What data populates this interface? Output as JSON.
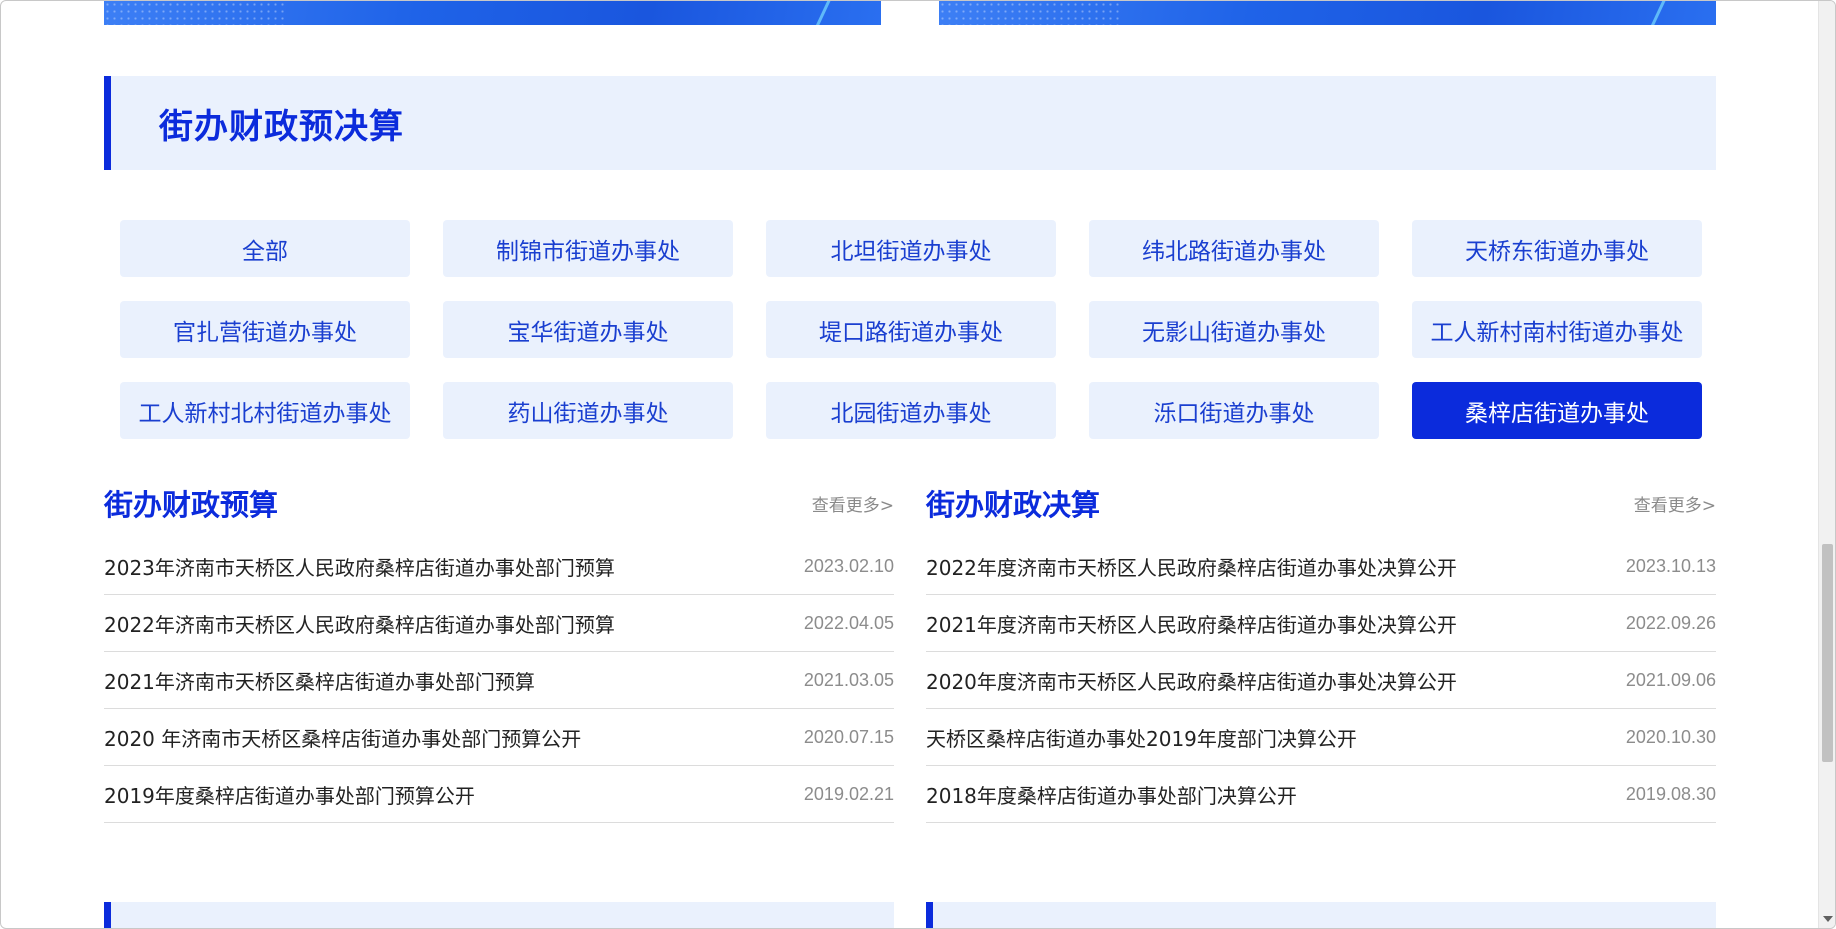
{
  "section": {
    "title": "街办财政预决算"
  },
  "filters": [
    {
      "label": "全部",
      "active": false
    },
    {
      "label": "制锦市街道办事处",
      "active": false
    },
    {
      "label": "北坦街道办事处",
      "active": false
    },
    {
      "label": "纬北路街道办事处",
      "active": false
    },
    {
      "label": "天桥东街道办事处",
      "active": false
    },
    {
      "label": "官扎营街道办事处",
      "active": false
    },
    {
      "label": "宝华街道办事处",
      "active": false
    },
    {
      "label": "堤口路街道办事处",
      "active": false
    },
    {
      "label": "无影山街道办事处",
      "active": false
    },
    {
      "label": "工人新村南村街道办事处",
      "active": false
    },
    {
      "label": "工人新村北村街道办事处",
      "active": false
    },
    {
      "label": "药山街道办事处",
      "active": false
    },
    {
      "label": "北园街道办事处",
      "active": false
    },
    {
      "label": "泺口街道办事处",
      "active": false
    },
    {
      "label": "桑梓店街道办事处",
      "active": true
    }
  ],
  "budget": {
    "title": "街办财政预算",
    "more": "查看更多>",
    "items": [
      {
        "title": "2023年济南市天桥区人民政府桑梓店街道办事处部门预算",
        "date": "2023.02.10"
      },
      {
        "title": "2022年济南市天桥区人民政府桑梓店街道办事处部门预算",
        "date": "2022.04.05"
      },
      {
        "title": "2021年济南市天桥区桑梓店街道办事处部门预算",
        "date": "2021.03.05"
      },
      {
        "title": "2020 年济南市天桥区桑梓店街道办事处部门预算公开",
        "date": "2020.07.15"
      },
      {
        "title": "2019年度桑梓店街道办事处部门预算公开",
        "date": "2019.02.21"
      }
    ]
  },
  "final_accounts": {
    "title": "街办财政决算",
    "more": "查看更多>",
    "items": [
      {
        "title": "2022年度济南市天桥区人民政府桑梓店街道办事处决算公开",
        "date": "2023.10.13"
      },
      {
        "title": "2021年度济南市天桥区人民政府桑梓店街道办事处决算公开",
        "date": "2022.09.26"
      },
      {
        "title": "2020年度济南市天桥区人民政府桑梓店街道办事处决算公开",
        "date": "2021.09.06"
      },
      {
        "title": "天桥区桑梓店街道办事处2019年度部门决算公开",
        "date": "2020.10.30"
      },
      {
        "title": "2018年度桑梓店街道办事处部门决算公开",
        "date": "2019.08.30"
      }
    ]
  },
  "colors": {
    "accent": "#0b2bdc",
    "tint": "#eaf1fd"
  }
}
